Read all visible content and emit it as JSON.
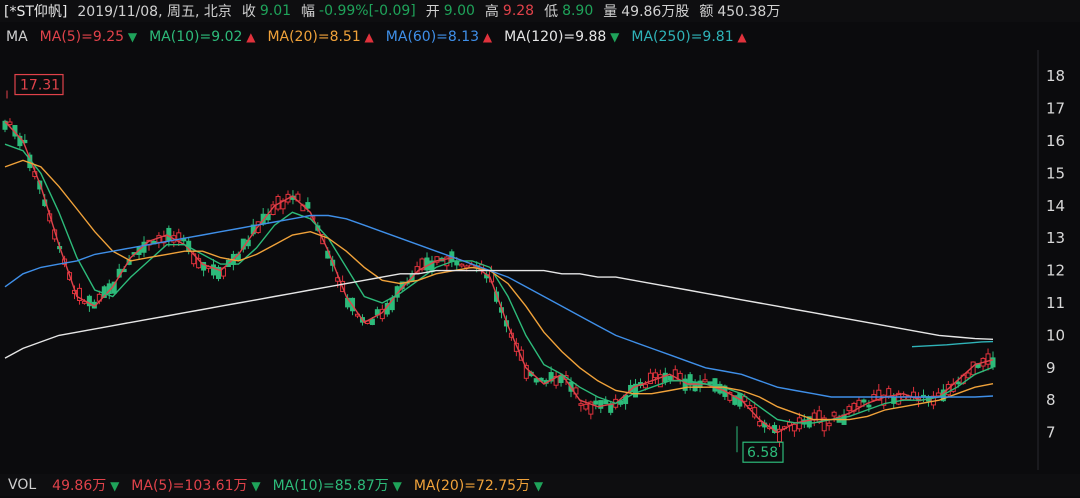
{
  "header": {
    "name": "[*ST仰帆]",
    "date": "2019/11/08, 周五, 北京",
    "close_label": "收",
    "close_value": "9.01",
    "change_label": "幅",
    "change_value": "-0.99%[-0.09]",
    "open_label": "开",
    "open_value": "9.00",
    "high_label": "高",
    "high_value": "9.28",
    "low_label": "低",
    "low_value": "8.90",
    "volume_label": "量",
    "volume_value": "49.86万股",
    "amount_label": "额",
    "amount_value": "450.38万"
  },
  "ma_bar": {
    "label": "MA",
    "items": [
      {
        "text": "MA(5)=9.25",
        "color": "#e0424a",
        "dir": "down"
      },
      {
        "text": "MA(10)=9.02",
        "color": "#2dbb7a",
        "dir": "up"
      },
      {
        "text": "MA(20)=8.51",
        "color": "#f0a23a",
        "dir": "up"
      },
      {
        "text": "MA(60)=8.13",
        "color": "#3f8fe8",
        "dir": "up"
      },
      {
        "text": "MA(120)=9.88",
        "color": "#e6e6e6",
        "dir": "down"
      },
      {
        "text": "MA(250)=9.81",
        "color": "#2fb3b8",
        "dir": "up"
      }
    ]
  },
  "vol_bar": {
    "label": "VOL",
    "items": [
      {
        "text": "49.86万",
        "color": "#e0424a",
        "dir": "down"
      },
      {
        "text": "MA(5)=103.61万",
        "color": "#e0424a",
        "dir": "down"
      },
      {
        "text": "MA(10)=85.87万",
        "color": "#2dbb7a",
        "dir": "down"
      },
      {
        "text": "MA(20)=72.75万",
        "color": "#f0a23a",
        "dir": "down"
      }
    ]
  },
  "price_axis": [
    "18",
    "17",
    "16",
    "15",
    "14",
    "13",
    "12",
    "11",
    "10",
    "9",
    "8",
    "7"
  ],
  "annotations": {
    "high_label": "17.31",
    "low_label": "6.58"
  },
  "chart_data": {
    "type": "candlestick",
    "y_range": [
      6.0,
      18.5
    ],
    "candles_description": "daily candles, ~300 sessions",
    "ma_series": [
      {
        "name": "MA(5)",
        "color": "#e0424a",
        "values": [
          16.6,
          16.0,
          14.6,
          12.8,
          11.2,
          10.9,
          11.5,
          12.4,
          12.9,
          13.1,
          12.8,
          12.2,
          12.0,
          12.5,
          13.3,
          14.0,
          14.3,
          13.8,
          12.6,
          11.2,
          10.4,
          10.7,
          11.4,
          12.0,
          12.3,
          12.4,
          12.2,
          11.8,
          10.3,
          9.0,
          8.5,
          8.8,
          8.0,
          7.8,
          7.9,
          8.4,
          8.6,
          8.8,
          8.5,
          8.5,
          8.3,
          8.0,
          7.4,
          7.0,
          7.3,
          7.4,
          7.4,
          7.6,
          7.9,
          8.1,
          8.2,
          8.0,
          8.1,
          8.6,
          9.1,
          9.25
        ]
      },
      {
        "name": "MA(10)",
        "color": "#2dbb7a",
        "values": [
          15.9,
          15.7,
          15.0,
          13.8,
          12.4,
          11.4,
          11.2,
          11.8,
          12.3,
          12.8,
          12.8,
          12.5,
          12.2,
          12.2,
          12.7,
          13.4,
          13.8,
          13.6,
          13.0,
          12.1,
          11.2,
          11.0,
          11.3,
          11.7,
          12.1,
          12.3,
          12.3,
          12.1,
          11.2,
          10.0,
          9.1,
          8.8,
          8.4,
          8.1,
          7.9,
          8.2,
          8.4,
          8.6,
          8.6,
          8.5,
          8.4,
          8.2,
          7.8,
          7.4,
          7.3,
          7.3,
          7.4,
          7.5,
          7.7,
          7.9,
          8.0,
          8.0,
          8.1,
          8.4,
          8.8,
          9.02
        ]
      },
      {
        "name": "MA(20)",
        "color": "#f0a23a",
        "values": [
          15.2,
          15.4,
          15.2,
          14.6,
          13.9,
          13.2,
          12.6,
          12.3,
          12.4,
          12.5,
          12.6,
          12.6,
          12.4,
          12.3,
          12.5,
          12.8,
          13.1,
          13.2,
          13.0,
          12.6,
          12.1,
          11.7,
          11.6,
          11.7,
          11.9,
          12.0,
          12.1,
          12.0,
          11.6,
          10.9,
          10.1,
          9.5,
          9.0,
          8.6,
          8.3,
          8.2,
          8.2,
          8.3,
          8.4,
          8.4,
          8.4,
          8.3,
          8.1,
          7.8,
          7.6,
          7.4,
          7.4,
          7.4,
          7.5,
          7.7,
          7.8,
          7.9,
          8.0,
          8.2,
          8.4,
          8.51
        ]
      },
      {
        "name": "MA(60)",
        "color": "#3f8fe8",
        "values": [
          11.5,
          11.9,
          12.1,
          12.2,
          12.3,
          12.5,
          12.6,
          12.7,
          12.8,
          12.9,
          13.0,
          13.1,
          13.2,
          13.3,
          13.4,
          13.5,
          13.6,
          13.7,
          13.7,
          13.6,
          13.4,
          13.2,
          13.0,
          12.8,
          12.6,
          12.4,
          12.2,
          12.0,
          11.8,
          11.5,
          11.2,
          10.9,
          10.6,
          10.3,
          10.0,
          9.8,
          9.6,
          9.4,
          9.2,
          9.0,
          8.9,
          8.8,
          8.6,
          8.4,
          8.3,
          8.2,
          8.1,
          8.1,
          8.1,
          8.1,
          8.1,
          8.1,
          8.1,
          8.1,
          8.1,
          8.13
        ]
      },
      {
        "name": "MA(120)",
        "color": "#e6e6e6",
        "values": [
          9.3,
          9.6,
          9.8,
          10.0,
          10.1,
          10.2,
          10.3,
          10.4,
          10.5,
          10.6,
          10.7,
          10.8,
          10.9,
          11.0,
          11.1,
          11.2,
          11.3,
          11.4,
          11.5,
          11.6,
          11.7,
          11.8,
          11.9,
          11.9,
          12.0,
          12.0,
          12.0,
          12.0,
          12.0,
          12.0,
          12.0,
          11.9,
          11.9,
          11.8,
          11.8,
          11.7,
          11.6,
          11.5,
          11.4,
          11.3,
          11.2,
          11.1,
          11.0,
          10.9,
          10.8,
          10.7,
          10.6,
          10.5,
          10.4,
          10.3,
          10.2,
          10.1,
          10.0,
          9.95,
          9.9,
          9.88
        ]
      },
      {
        "name": "MA(250)",
        "color": "#2fb3b8",
        "values": [
          9.65,
          9.67,
          9.69,
          9.71,
          9.74,
          9.77,
          9.8,
          9.81
        ]
      }
    ]
  }
}
